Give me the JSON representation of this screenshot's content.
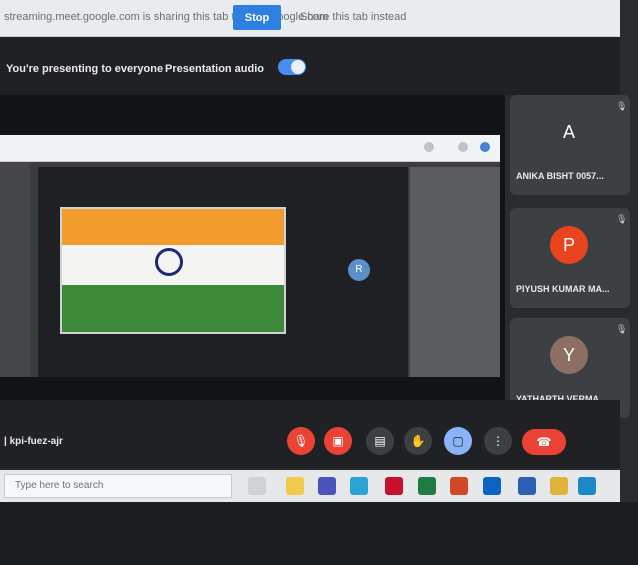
{
  "share_bar": {
    "message": "streaming.meet.google.com is sharing this tab to meet.google.com",
    "stop_label": "Stop",
    "hide_label": "Share this tab instead"
  },
  "meet_header": {
    "presenting_text": "You're presenting to everyone",
    "audio_label": "Presentation audio",
    "audio_on": true
  },
  "stage": {
    "remote_avatar_letter": "R"
  },
  "participants": [
    {
      "initial": "A",
      "name": "ANIKA BISHT 0057...",
      "color": "#3c4043"
    },
    {
      "initial": "P",
      "name": "PIYUSH KUMAR MA...",
      "color": "#e8451f"
    },
    {
      "initial": "Y",
      "name": "YATHARTH VERMA ...",
      "color": "#8d6e63"
    }
  ],
  "bottom_bar": {
    "meeting_code": "| kpi-fuez-ajr",
    "controls": [
      {
        "name": "mic-off-button",
        "icon": "mic-off-icon",
        "glyph": "🎙",
        "style": "red"
      },
      {
        "name": "camera-off-button",
        "icon": "camera-off-icon",
        "glyph": "▣",
        "style": "red"
      },
      {
        "name": "captions-button",
        "icon": "captions-icon",
        "glyph": "▤",
        "style": "dark"
      },
      {
        "name": "raise-hand-button",
        "icon": "hand-icon",
        "glyph": "✋",
        "style": "dark"
      },
      {
        "name": "present-button",
        "icon": "present-icon",
        "glyph": "▢",
        "style": "blue"
      },
      {
        "name": "more-options-button",
        "icon": "more-vert-icon",
        "glyph": "⋮",
        "style": "dark"
      }
    ],
    "hangup_glyph": "☎"
  },
  "taskbar": {
    "search_placeholder": "Type here to search",
    "apps": [
      {
        "name": "task-view-icon",
        "color": "#cfd3d7"
      },
      {
        "name": "file-explorer-icon",
        "color": "#f2c94c"
      },
      {
        "name": "teams-icon",
        "color": "#4b53bc"
      },
      {
        "name": "app-l-icon",
        "color": "#2aa3d6"
      },
      {
        "name": "mcafee-icon",
        "color": "#c8102e"
      },
      {
        "name": "excel-icon",
        "color": "#1f7a44"
      },
      {
        "name": "powerpoint-icon",
        "color": "#d24726"
      },
      {
        "name": "outlook-icon",
        "color": "#0a64c6"
      },
      {
        "name": "word-icon",
        "color": "#2b5fb4"
      },
      {
        "name": "chrome-icon",
        "color": "#e0b43a"
      },
      {
        "name": "edge-icon",
        "color": "#1e88c9"
      }
    ]
  },
  "colors": {
    "accent": "#2d7fe0",
    "danger": "#ea4335",
    "surface": "#202124"
  }
}
